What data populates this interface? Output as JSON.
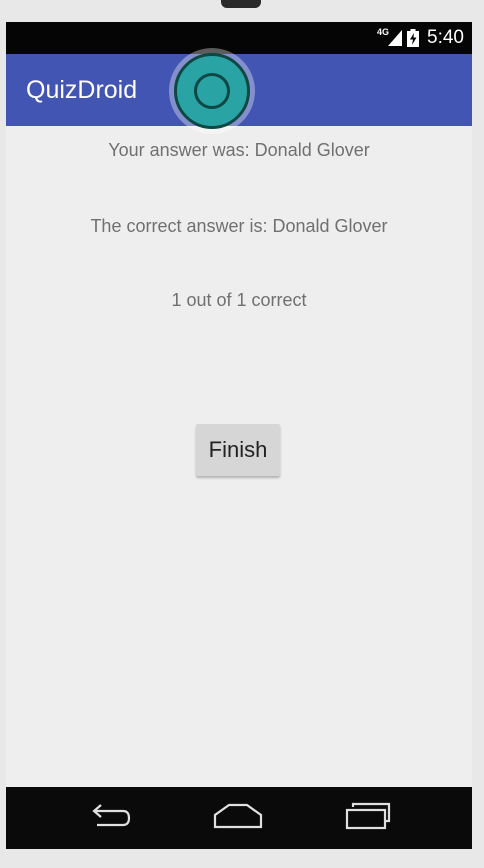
{
  "status_bar": {
    "network": "4G",
    "time": "5:40",
    "icons": [
      "signal-icon",
      "battery-charging-icon"
    ]
  },
  "app_bar": {
    "title": "QuizDroid",
    "color": "#4355b3"
  },
  "result": {
    "your_answer": "Your answer was: Donald Glover",
    "correct_answer": "The correct answer is: Donald Glover",
    "score": "1 out of 1 correct"
  },
  "actions": {
    "finish_label": "Finish"
  },
  "nav_bar": {
    "icons": [
      "back-icon",
      "home-icon",
      "recents-icon"
    ]
  },
  "touch_indicator": {
    "color": "#2aa3a4"
  }
}
